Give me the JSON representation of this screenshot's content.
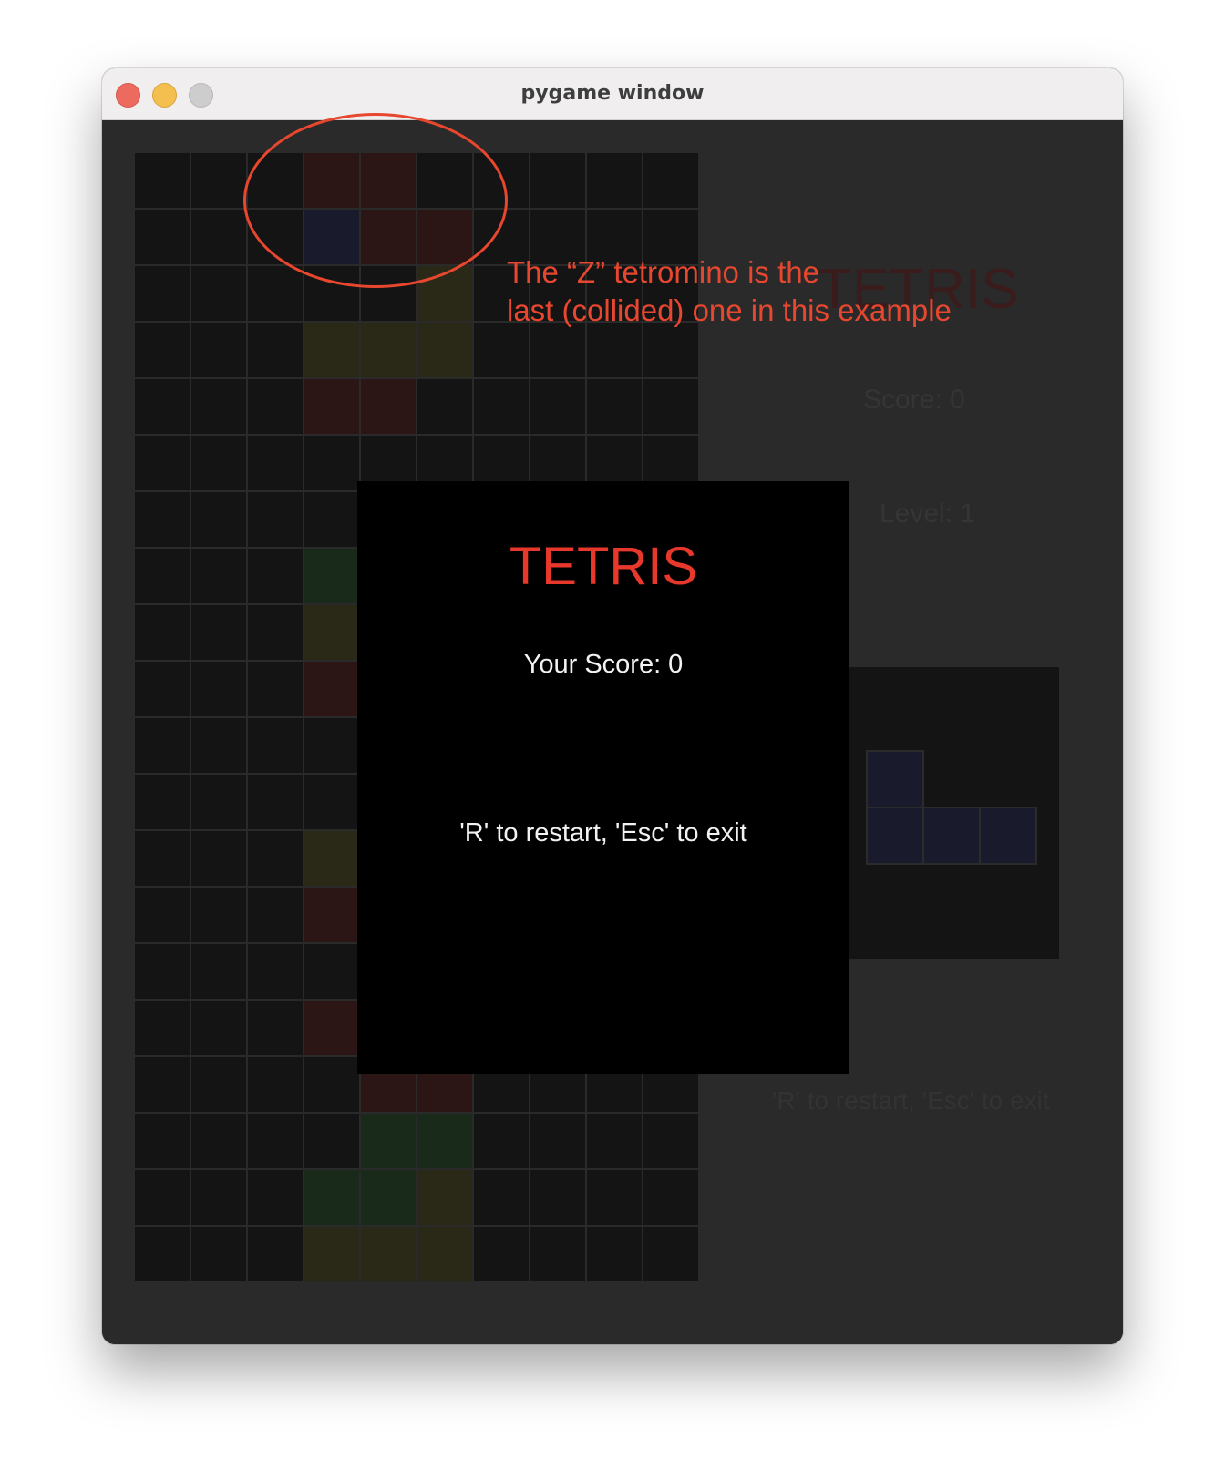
{
  "window": {
    "title": "pygame window",
    "controls": [
      "close",
      "minimize",
      "maximize"
    ]
  },
  "game": {
    "board_columns": 10,
    "board_rows": 20,
    "cell_color_empty": "#141414",
    "piece_colors": {
      "R": "#2c1515",
      "B": "#191a2b",
      "Y": "#2a2917",
      "G": "#1a2a1a"
    },
    "board_rows_data": [
      "...RR.....",
      "...BRR....",
      ".....Y....",
      "...YYY....",
      "...RR.....",
      "..........",
      "..........",
      "...G......",
      "...Y......",
      "...R......",
      "..........",
      "..........",
      "...Y......",
      "...R......",
      "..........",
      "...RR.....",
      "....RR....",
      "....GG....",
      "...GGY....",
      "...YYY...."
    ],
    "side_panel": {
      "title": "TETRIS",
      "score_label": "Score: 0",
      "level_label": "Level: 1",
      "next_piece_visible_cells": 4,
      "restart_hint": "'R' to restart, 'Esc' to exit"
    },
    "game_over_dialog": {
      "title": "TETRIS",
      "score_label": "Your Score:",
      "score_value": "0",
      "help": "'R' to restart, 'Esc' to exit"
    }
  },
  "annotation": {
    "line1": "The “Z” tetromino is the",
    "line2": "last (collided) one in this example",
    "color": "#e8472f"
  }
}
